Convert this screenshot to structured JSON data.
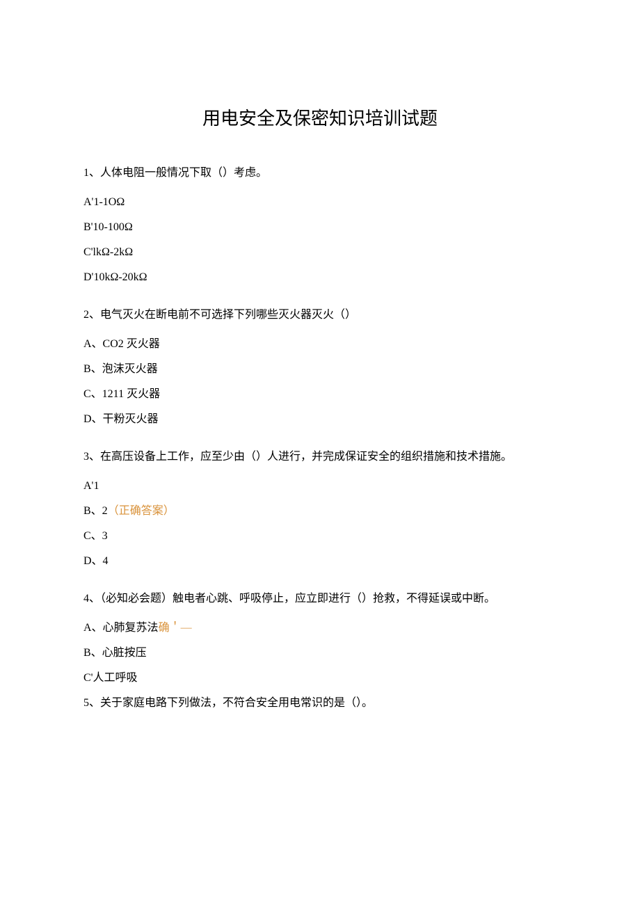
{
  "title": "用电安全及保密知识培训试题",
  "q1": {
    "text": "1、人体电阻一般情况下取（）考虑。",
    "a": "A'1-1OΩ",
    "b": "B'10-100Ω",
    "c": "C'lkΩ-2kΩ",
    "d": "D'10kΩ-20kΩ"
  },
  "q2": {
    "text": "2、电气灭火在断电前不可选择下列哪些灭火器灭火（）",
    "a": "A、CO2 灭火器",
    "b": "B、泡沫灭火器",
    "c": "C、1211 灭火器",
    "d": "D、干粉灭火器"
  },
  "q3": {
    "text": "3、在高压设备上工作，应至少由（）人进行，并完成保证安全的组织措施和技术措施。",
    "a": "A'1",
    "b_prefix": "B、2",
    "b_annot": "（正确答案）",
    "c": "C、3",
    "d": "D、4"
  },
  "q4": {
    "text": "4、（必知必会题）触电者心跳、呼吸停止，应立即进行（）抢救，不得延误或中断。",
    "a_prefix": "A、心肺复苏法",
    "a_annot": "确＇—",
    "b": "B、心脏按压",
    "c": "C'人工呼吸"
  },
  "q5": {
    "text": "5、关于家庭电路下列做法，不符合安全用电常识的是（）。"
  }
}
